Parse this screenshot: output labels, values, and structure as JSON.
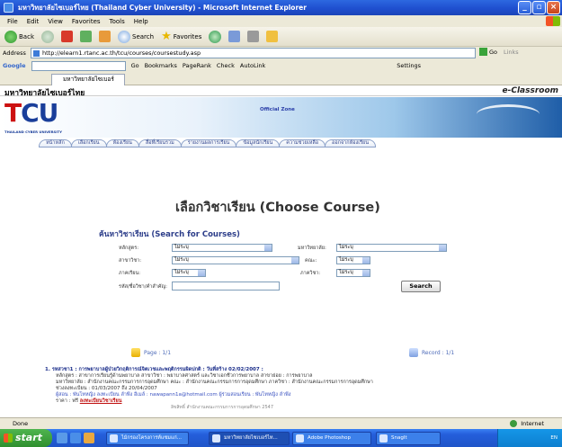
{
  "window": {
    "title": "มหาวิทยาลัยไซเบอร์ไทย (Thailand Cyber University) - Microsoft Internet Explorer"
  },
  "menu": [
    "File",
    "Edit",
    "View",
    "Favorites",
    "Tools",
    "Help"
  ],
  "toolbar": {
    "back": "Back",
    "search": "Search",
    "favorites": "Favorites"
  },
  "address": {
    "label": "Address",
    "url": "http://elearn1.rtanc.ac.th/tcu/courses/coursestudy.asp",
    "go": "Go",
    "links": "Links"
  },
  "googlebar": {
    "label": "Google",
    "go": "Go",
    "bookmarks": "Bookmarks",
    "pagerank": "PageRank",
    "check": "Check",
    "autolink": "AutoLink",
    "settings": "Settings"
  },
  "tab": {
    "label": "มหาวิทยาลัยไซเบอร์ไท..."
  },
  "site": {
    "name": "มหาวิทยาลัยไซเบอร์ไทย",
    "eclassroom": "e-Classroom",
    "logo_sub": "THAILAND CYBER UNIVERSITY",
    "official": "Official Zone"
  },
  "nav": [
    "หน้าหลัก",
    "เลือกเรียน",
    "ห้องเรียน",
    "สื่อที่เรียนรวม",
    "รายงานผลการเรียน",
    "ข้อมูลนักเรียน",
    "ความช่วยเหลือ",
    "ออกจากห้องเรียน"
  ],
  "page": {
    "title": "เลือกวิชาเรียน (Choose Course)"
  },
  "search": {
    "heading": "ค้นหาวิชาเรียน (Search for Courses)",
    "program_label": "หลักสูตร:",
    "program_value": "ไม่ระบุ",
    "university_label": "มหาวิทยาลัย:",
    "university_value": "ไม่ระบุ",
    "subject_label": "สาขาวิชา:",
    "subject_value": "ไม่ระบุ",
    "faculty_label": "คณะ:",
    "faculty_value": "ไม่ระบุ",
    "category_label": "ภาคเรียน:",
    "category_value": "ไม่ระบุ",
    "term_label": "ภาควิชา:",
    "term_value": "ไม่ระบุ",
    "keyword_label": "รหัส/ชื่อวิชา/คำสำคัญ:",
    "keyword_value": "",
    "button": "Search"
  },
  "pager": {
    "page": "Page : 1/1",
    "record": "Record : 1/1"
  },
  "result": {
    "title": "1. รหสวชา1 : การพยาบาลผู้ป่วยวิกฤติการณ์จิตเวชและพฤติกรรมผิดปกติ : วันที่สร้าง 02/02/2007 :",
    "line1": "หลักสูตร : สาขาการเรียนรู้ด้านพยาบาล   สาขาวิชา : พยาบาลศาสตร์ และวิชาเอกชีวการพยาบาล   สาขาย่อย : การพยาบาล",
    "line2": "มหาวิทยาลัย : สำนักงานคณะกรรมการการอุดมศึกษา   คณะ : สำนักงานคณะกรรมการการอุดมศึกษา   ภาควิชา : สำนักงานคณะกรรมการการอุดมศึกษา",
    "line3": "ช่วงลงทะเบียน : 01/03/2007 ถึง 20/04/2007",
    "line4": "ผู้สอน : พันโทหญิง ลงทะเบียน ลำพึง   อีเมล์ : nawapann1a@hotmail.com   ผู้ร่วมสอนเรียน : พันโทหญิง ลำพึง",
    "line5": "ราคา : ฟรี",
    "enroll": "ลงทะเบียนวิชาเรียน"
  },
  "footer": "ลิขสิทธิ์ สำนักงานคณะกรรมการการอุดมศึกษา   2547",
  "status": {
    "left": "Done",
    "zone": "Internet"
  },
  "taskbar": {
    "start": "start",
    "items": [
      "ไม้กรองโครงการท์แซมแก่...",
      "มหาวิทยาลัยไซเบอร์ไท...",
      "Adobe Photoshop",
      "SnagIt"
    ],
    "tray": "EN"
  }
}
